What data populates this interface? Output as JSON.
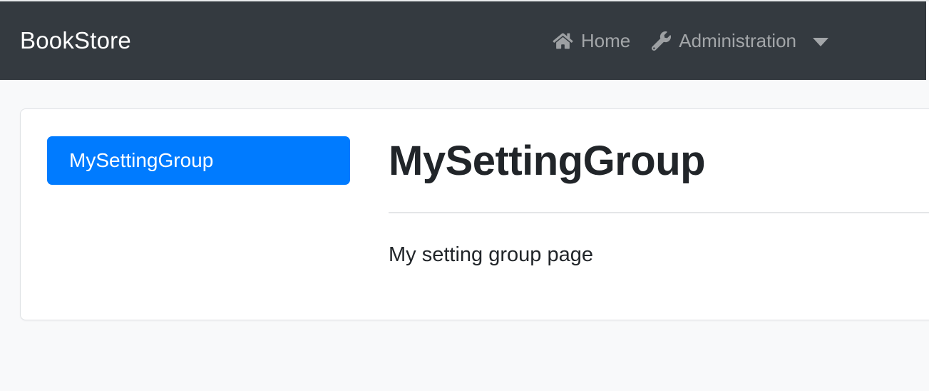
{
  "navbar": {
    "brand": "BookStore",
    "links": [
      {
        "label": "Home",
        "icon": "home-icon"
      },
      {
        "label": "Administration",
        "icon": "wrench-icon",
        "has_dropdown": true
      }
    ]
  },
  "settings": {
    "groups": [
      {
        "label": "MySettingGroup",
        "active": true
      }
    ],
    "selected": {
      "title": "MySettingGroup",
      "body": "My setting group page"
    }
  },
  "colors": {
    "navbar_bg": "#343a40",
    "primary": "#007bff",
    "page_bg": "#f8f9fa",
    "card_border": "#dfe2e5",
    "text": "#212529",
    "nav_link": "rgba(255,255,255,0.55)"
  }
}
